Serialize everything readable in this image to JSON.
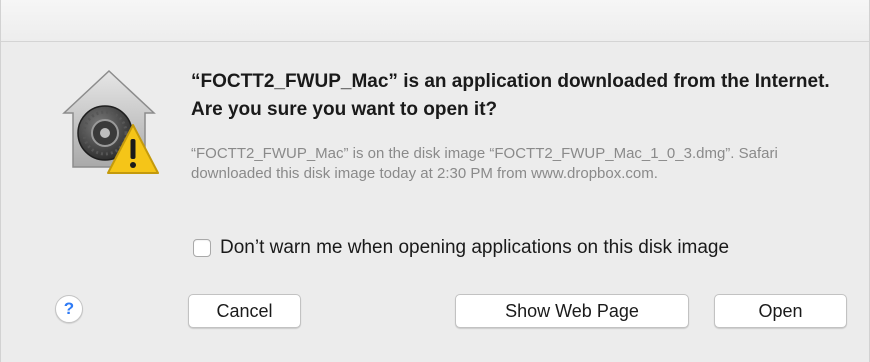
{
  "dialog": {
    "heading": "“FOCTT2_FWUP_Mac” is an application downloaded from the Internet. Are you sure you want to open it?",
    "info": "“FOCTT2_FWUP_Mac” is on the disk image “FOCTT2_FWUP_Mac_1_0_3.dmg”. Safari downloaded this disk image today at 2:30 PM from www.dropbox.com.",
    "checkbox_label": "Don’t warn me when opening applications on this disk image",
    "checkbox_checked": false,
    "icon": "gatekeeper-warning-icon"
  },
  "buttons": {
    "help": "?",
    "cancel": "Cancel",
    "show_web_page": "Show Web Page",
    "open": "Open"
  },
  "colors": {
    "background": "#ececec",
    "warning": "#f5c518",
    "help_accent": "#2f7bf5"
  }
}
